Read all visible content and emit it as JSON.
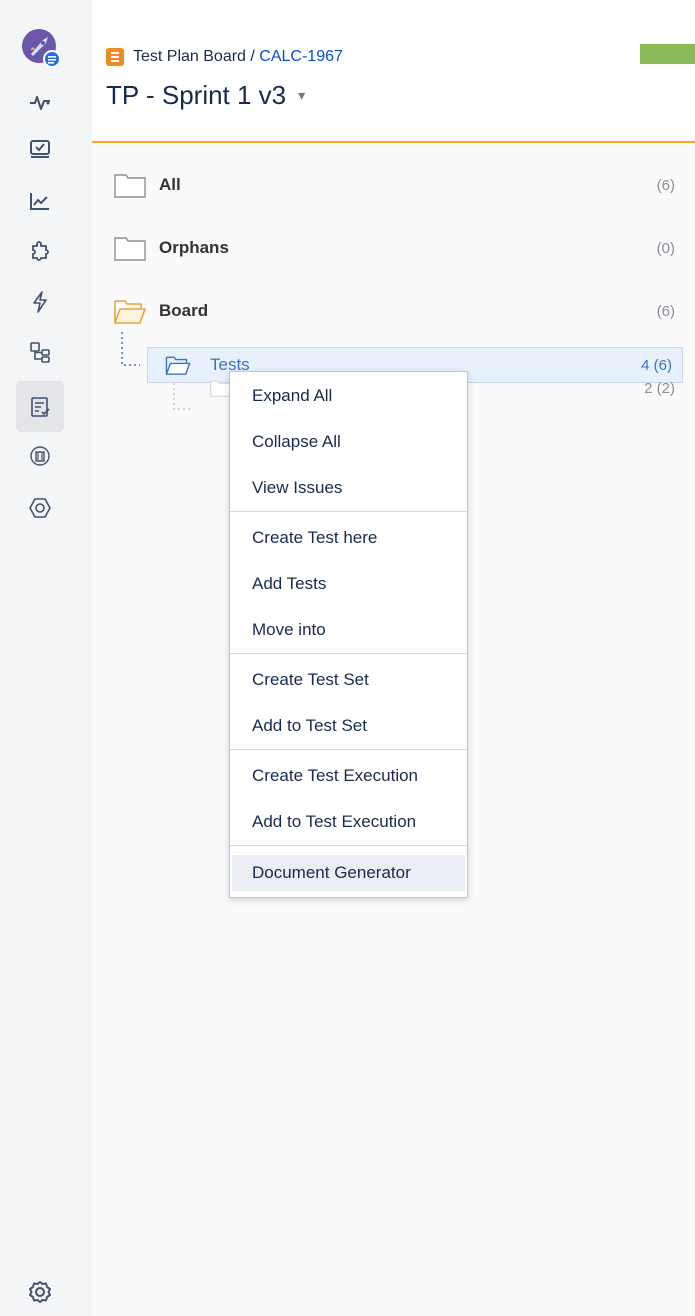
{
  "header": {
    "breadcrumb_project": "Test Plan Board",
    "breadcrumb_separator": " / ",
    "breadcrumb_key": "CALC-1967",
    "title": "TP - Sprint 1 v3"
  },
  "sidebar": {
    "icons": [
      "rocket-avatar",
      "pulse-icon",
      "board-icon",
      "chart-icon",
      "puzzle-icon",
      "lightning-icon",
      "tree-icon",
      "test-list-icon",
      "archive-icon",
      "hexagon-icon",
      "settings-gear-icon"
    ],
    "selected": "test-list-icon"
  },
  "tree": {
    "items": [
      {
        "label": "All",
        "count": "(6)"
      },
      {
        "label": "Orphans",
        "count": "(0)"
      },
      {
        "label": "Board",
        "count": "(6)"
      },
      {
        "label": "Tests",
        "count": "4 (6)"
      },
      {
        "label": "",
        "count": "2 (2)"
      }
    ]
  },
  "context_menu": {
    "items": [
      "Expand All",
      "Collapse All",
      "View Issues",
      "Create Test here",
      "Add Tests",
      "Move into",
      "Create Test Set",
      "Add to Test Set",
      "Create Test Execution",
      "Add to Test Execution",
      "Document Generator"
    ],
    "hovered": "Document Generator"
  },
  "colors": {
    "accent_orange": "#f6a623",
    "link_blue": "#0052cc",
    "status_green": "#8bb957"
  }
}
